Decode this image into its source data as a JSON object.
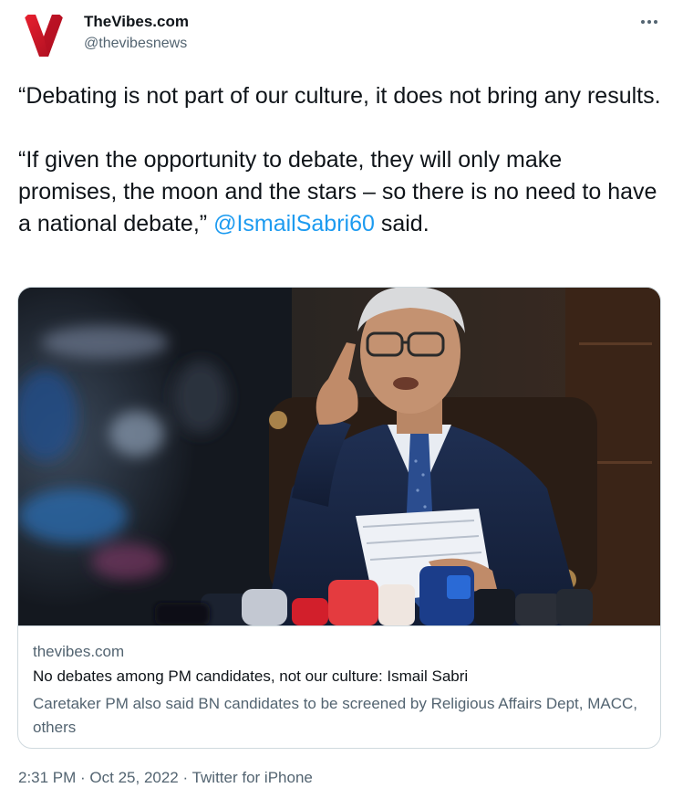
{
  "author": {
    "name": "TheVibes.com",
    "handle": "@thevibesnews",
    "avatar_icon": "thevibes-logo-icon",
    "avatar_color": "#d0102a"
  },
  "more_icon": "more-horizontal-icon",
  "tweet": {
    "paragraph1": "“Debating is not part of our culture, it does not bring any results.",
    "paragraph2_prefix": "“If given the opportunity to debate, they will only make promises, the moon and the stars – so there is no need to have a national debate,” ",
    "mention": "@IsmailSabri60",
    "paragraph2_suffix": " said."
  },
  "card": {
    "image_description_icon": "news-photo",
    "domain": "thevibes.com",
    "title": "No debates among PM candidates, not our culture: Ismail Sabri",
    "description": "Caretaker PM also said BN candidates to be screened by Religious Affairs Dept, MACC, others"
  },
  "meta": {
    "time": "2:31 PM",
    "separator": " · ",
    "date": "Oct 25, 2022",
    "source": "Twitter for iPhone"
  },
  "colors": {
    "link": "#1d9bf0",
    "secondary_text": "#536471",
    "border": "#cfd9de"
  }
}
